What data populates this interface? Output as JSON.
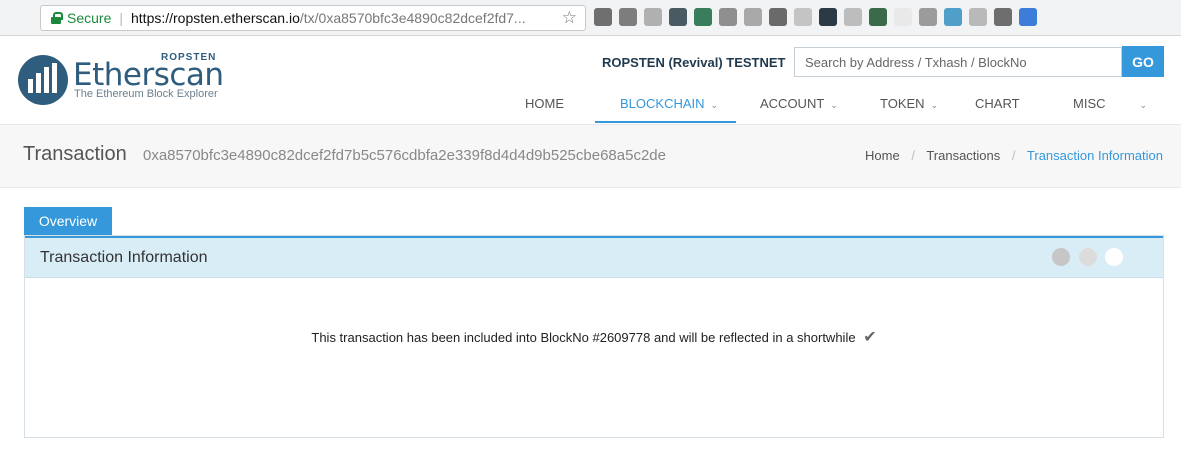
{
  "browser": {
    "secure_label": "Secure",
    "url_host": "https://ropsten.etherscan.io",
    "url_path": "/tx/0xa8570bfc3e4890c82dcef2fd7...",
    "extensions": [
      {
        "name": "ext-1-icon",
        "color": "#6f6f6f"
      },
      {
        "name": "ext-2-icon",
        "color": "#7d7d7d"
      },
      {
        "name": "ext-3-icon",
        "color": "#b0b0b0"
      },
      {
        "name": "ext-4-icon",
        "color": "#4a5a63"
      },
      {
        "name": "ext-5-icon",
        "color": "#3a7d5c"
      },
      {
        "name": "ext-6-icon",
        "color": "#8f8f8f"
      },
      {
        "name": "ext-7-icon",
        "color": "#a8a8a8"
      },
      {
        "name": "ext-8-icon",
        "color": "#6a6a6a"
      },
      {
        "name": "ext-9-icon",
        "color": "#c4c4c4"
      },
      {
        "name": "ext-10-icon",
        "color": "#2b3a44"
      },
      {
        "name": "ext-11-icon",
        "color": "#bdbdbd"
      },
      {
        "name": "ext-12-icon",
        "color": "#3b6a4a"
      },
      {
        "name": "ext-13-icon",
        "color": "#e9e9e9"
      },
      {
        "name": "ext-14-icon",
        "color": "#9b9b9b"
      },
      {
        "name": "ext-15-icon",
        "color": "#4f9fc9"
      },
      {
        "name": "ext-16-icon",
        "color": "#b9b9b9"
      },
      {
        "name": "ext-17-icon",
        "color": "#6e6e6e"
      },
      {
        "name": "ext-18-icon",
        "color": "#3b7dd8"
      }
    ]
  },
  "logo": {
    "name": "Etherscan",
    "network_badge": "ROPSTEN",
    "tagline": "The Ethereum Block Explorer"
  },
  "header": {
    "network_label": "ROPSTEN (Revival) TESTNET",
    "search_placeholder": "Search by Address / Txhash / BlockNo",
    "go_label": "GO"
  },
  "nav": [
    {
      "label": "HOME",
      "has_caret": false,
      "active": false
    },
    {
      "label": "BLOCKCHAIN",
      "has_caret": true,
      "active": true
    },
    {
      "label": "ACCOUNT",
      "has_caret": true,
      "active": false
    },
    {
      "label": "TOKEN",
      "has_caret": true,
      "active": false
    },
    {
      "label": "CHART",
      "has_caret": false,
      "active": false
    },
    {
      "label": "MISC",
      "has_caret": true,
      "active": false
    }
  ],
  "page": {
    "title": "Transaction",
    "tx_hash": "0xa8570bfc3e4890c82dcef2fd7b5c576cdbfa2e339f8d4d4d9b525cbe68a5c2de",
    "breadcrumb": [
      "Home",
      "Transactions",
      "Transaction Information"
    ]
  },
  "panel": {
    "tab_label": "Overview",
    "title": "Transaction Information",
    "message": "This transaction has been included into BlockNo #2609778 and will be reflected in a shortwhile",
    "check_icon": "check-icon",
    "colors": {
      "accent": "#3498db",
      "header_bg": "#d9edf7"
    }
  }
}
